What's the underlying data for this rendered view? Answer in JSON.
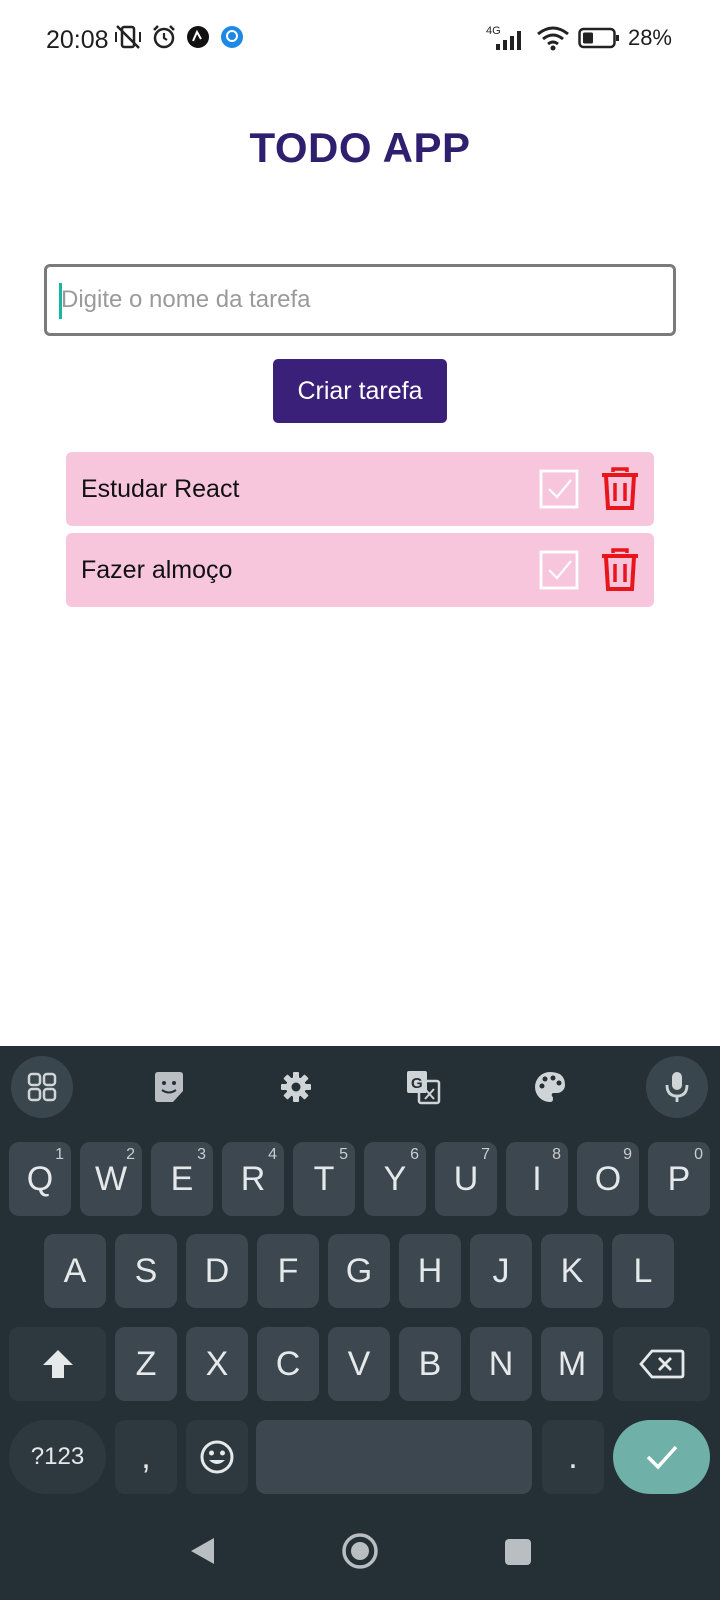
{
  "status_bar": {
    "time": "20:08",
    "network": "4G",
    "battery": "28%"
  },
  "app": {
    "title": "TODO APP",
    "input": {
      "placeholder": "Digite o nome da tarefa",
      "value": ""
    },
    "create_button": "Criar tarefa",
    "tasks": [
      {
        "name": "Estudar React"
      },
      {
        "name": "Fazer almoço"
      }
    ],
    "colors": {
      "primary": "#3b2079",
      "task_bg": "#f7c6dc",
      "delete": "#e8161b",
      "title": "#2f1f6e"
    }
  },
  "keyboard": {
    "toolbar": [
      "apps-grid-icon",
      "sticker-icon",
      "gear-icon",
      "translate-icon",
      "palette-icon",
      "microphone-icon"
    ],
    "row1": [
      {
        "k": "Q",
        "h": "1"
      },
      {
        "k": "W",
        "h": "2"
      },
      {
        "k": "E",
        "h": "3"
      },
      {
        "k": "R",
        "h": "4"
      },
      {
        "k": "T",
        "h": "5"
      },
      {
        "k": "Y",
        "h": "6"
      },
      {
        "k": "U",
        "h": "7"
      },
      {
        "k": "I",
        "h": "8"
      },
      {
        "k": "O",
        "h": "9"
      },
      {
        "k": "P",
        "h": "0"
      }
    ],
    "row2": [
      "A",
      "S",
      "D",
      "F",
      "G",
      "H",
      "J",
      "K",
      "L"
    ],
    "row3": [
      "Z",
      "X",
      "C",
      "V",
      "B",
      "N",
      "M"
    ],
    "symbols_key": "?123",
    "comma_key": ",",
    "period_key": "."
  }
}
